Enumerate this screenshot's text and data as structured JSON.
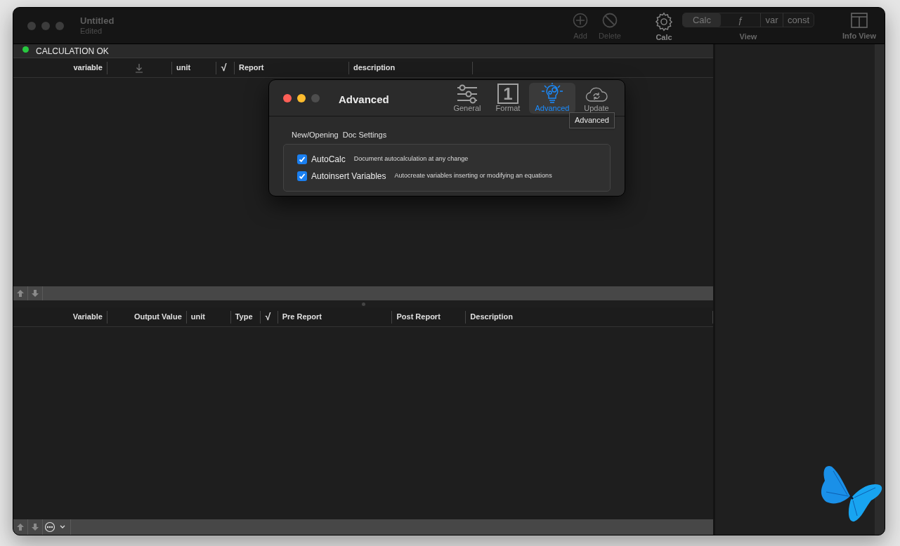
{
  "window": {
    "title": "Untitled",
    "subtitle": "Edited"
  },
  "toolbar": {
    "items": [
      {
        "kind": "add",
        "label": "Add",
        "disabled": true
      },
      {
        "kind": "delete",
        "label": "Delete",
        "disabled": true
      },
      {
        "kind": "gear",
        "label": "Calc",
        "disabled": false
      }
    ],
    "view": {
      "label": "View",
      "segments": [
        {
          "label": "Calc",
          "selected": true
        },
        {
          "label": "ƒ",
          "selected": false
        },
        {
          "label": "var",
          "selected": false
        },
        {
          "label": "const",
          "selected": false
        }
      ]
    },
    "info_view": {
      "label": "Info View"
    }
  },
  "status": {
    "text": "CALCULATION OK",
    "color": "#28c840"
  },
  "equations_table": {
    "columns": [
      {
        "kind": "text",
        "label": "variable"
      },
      {
        "kind": "icon"
      },
      {
        "kind": "text",
        "label": "unit"
      },
      {
        "kind": "text",
        "label": "√"
      },
      {
        "kind": "text",
        "label": "Report"
      },
      {
        "kind": "text",
        "label": "description"
      }
    ]
  },
  "results_table": {
    "columns": [
      {
        "label": "Variable"
      },
      {
        "label": "Output Value"
      },
      {
        "label": "unit"
      },
      {
        "label": "Type"
      },
      {
        "label": "√"
      },
      {
        "label": "Pre Report"
      },
      {
        "label": "Post Report"
      },
      {
        "label": "Description"
      }
    ]
  },
  "dialog": {
    "title": "Advanced",
    "tabs": [
      {
        "kind": "sliders",
        "label": "General",
        "selected": false
      },
      {
        "kind": "number",
        "label": "Format",
        "glyph": "1",
        "selected": false
      },
      {
        "kind": "bulb",
        "label": "Advanced",
        "selected": true
      },
      {
        "kind": "cloud",
        "label": "Update",
        "selected": false
      }
    ],
    "tooltip": "Advanced",
    "section": "New/Opening  Doc Settings",
    "options": [
      {
        "label": "AutoCalc",
        "description": "Document autocalculation at any change",
        "checked": true
      },
      {
        "label": "Autoinsert Variables",
        "description": "Autocreate variables inserting or modifying an equations",
        "checked": true
      }
    ]
  }
}
